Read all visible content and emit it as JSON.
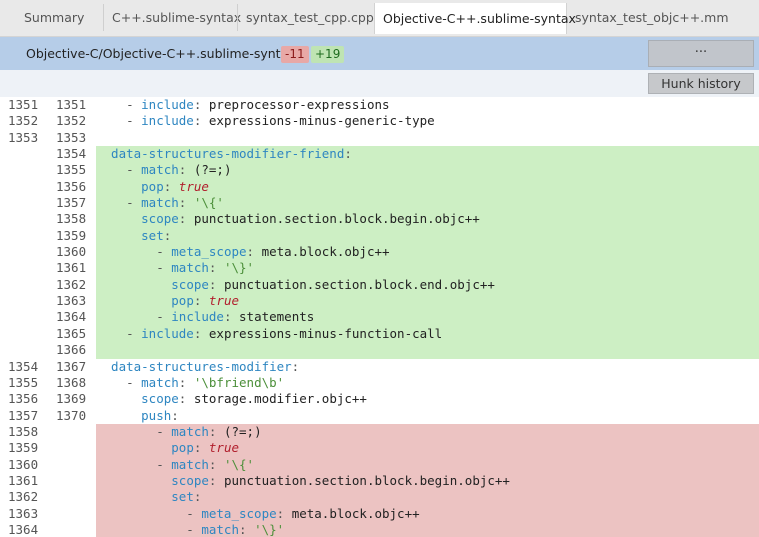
{
  "tabs": [
    {
      "label": "Summary",
      "active": false
    },
    {
      "label": "C++.sublime-syntax",
      "active": false
    },
    {
      "label": "syntax_test_cpp.cpp",
      "active": false
    },
    {
      "label": "Objective-C++.sublime-syntax",
      "active": true
    },
    {
      "label": "syntax_test_objc++.mm",
      "active": false
    }
  ],
  "file": {
    "path": "Objective-C/Objective-C++.sublime-syntax",
    "deletions": "-11",
    "additions": "+19",
    "more_label": "···"
  },
  "hunk": {
    "history_label": "Hunk history"
  },
  "colors": {
    "added_bg": "#cdefc4",
    "removed_bg": "#ecc3c2",
    "header_bg": "#b6cde8"
  },
  "lines": [
    {
      "type": "ctx",
      "old": "1351",
      "new": "1351",
      "tokens": [
        [
          "p",
          "    - "
        ],
        [
          "k",
          "include"
        ],
        [
          "p",
          ": "
        ],
        [
          "t",
          "preprocessor-expressions"
        ]
      ]
    },
    {
      "type": "ctx",
      "old": "1352",
      "new": "1352",
      "tokens": [
        [
          "p",
          "    - "
        ],
        [
          "k",
          "include"
        ],
        [
          "p",
          ": "
        ],
        [
          "t",
          "expressions-minus-generic-type"
        ]
      ]
    },
    {
      "type": "ctx",
      "old": "1353",
      "new": "1353",
      "tokens": []
    },
    {
      "type": "add",
      "old": "",
      "new": "1354",
      "tokens": [
        [
          "k",
          "  data-structures-modifier-friend"
        ],
        [
          "p",
          ":"
        ]
      ]
    },
    {
      "type": "add",
      "old": "",
      "new": "1355",
      "tokens": [
        [
          "p",
          "    - "
        ],
        [
          "k",
          "match"
        ],
        [
          "p",
          ": "
        ],
        [
          "t",
          "(?=;)"
        ]
      ]
    },
    {
      "type": "add",
      "old": "",
      "new": "1356",
      "tokens": [
        [
          "p",
          "      "
        ],
        [
          "k",
          "pop"
        ],
        [
          "p",
          ": "
        ],
        [
          "b",
          "true"
        ]
      ]
    },
    {
      "type": "add",
      "old": "",
      "new": "1357",
      "tokens": [
        [
          "p",
          "    - "
        ],
        [
          "k",
          "match"
        ],
        [
          "p",
          ": "
        ],
        [
          "s",
          "'\\{'"
        ]
      ]
    },
    {
      "type": "add",
      "old": "",
      "new": "1358",
      "tokens": [
        [
          "p",
          "      "
        ],
        [
          "k",
          "scope"
        ],
        [
          "p",
          ": "
        ],
        [
          "t",
          "punctuation.section.block.begin.objc++"
        ]
      ]
    },
    {
      "type": "add",
      "old": "",
      "new": "1359",
      "tokens": [
        [
          "p",
          "      "
        ],
        [
          "k",
          "set"
        ],
        [
          "p",
          ":"
        ]
      ]
    },
    {
      "type": "add",
      "old": "",
      "new": "1360",
      "tokens": [
        [
          "p",
          "        - "
        ],
        [
          "k",
          "meta_scope"
        ],
        [
          "p",
          ": "
        ],
        [
          "t",
          "meta.block.objc++"
        ]
      ]
    },
    {
      "type": "add",
      "old": "",
      "new": "1361",
      "tokens": [
        [
          "p",
          "        - "
        ],
        [
          "k",
          "match"
        ],
        [
          "p",
          ": "
        ],
        [
          "s",
          "'\\}'"
        ]
      ]
    },
    {
      "type": "add",
      "old": "",
      "new": "1362",
      "tokens": [
        [
          "p",
          "          "
        ],
        [
          "k",
          "scope"
        ],
        [
          "p",
          ": "
        ],
        [
          "t",
          "punctuation.section.block.end.objc++"
        ]
      ]
    },
    {
      "type": "add",
      "old": "",
      "new": "1363",
      "tokens": [
        [
          "p",
          "          "
        ],
        [
          "k",
          "pop"
        ],
        [
          "p",
          ": "
        ],
        [
          "b",
          "true"
        ]
      ]
    },
    {
      "type": "add",
      "old": "",
      "new": "1364",
      "tokens": [
        [
          "p",
          "        - "
        ],
        [
          "k",
          "include"
        ],
        [
          "p",
          ": "
        ],
        [
          "t",
          "statements"
        ]
      ]
    },
    {
      "type": "add",
      "old": "",
      "new": "1365",
      "tokens": [
        [
          "p",
          "    - "
        ],
        [
          "k",
          "include"
        ],
        [
          "p",
          ": "
        ],
        [
          "t",
          "expressions-minus-function-call"
        ]
      ]
    },
    {
      "type": "add",
      "old": "",
      "new": "1366",
      "tokens": []
    },
    {
      "type": "ctx",
      "old": "1354",
      "new": "1367",
      "tokens": [
        [
          "k",
          "  data-structures-modifier"
        ],
        [
          "p",
          ":"
        ]
      ]
    },
    {
      "type": "ctx",
      "old": "1355",
      "new": "1368",
      "tokens": [
        [
          "p",
          "    - "
        ],
        [
          "k",
          "match"
        ],
        [
          "p",
          ": "
        ],
        [
          "s",
          "'\\bfriend\\b'"
        ]
      ]
    },
    {
      "type": "ctx",
      "old": "1356",
      "new": "1369",
      "tokens": [
        [
          "p",
          "      "
        ],
        [
          "k",
          "scope"
        ],
        [
          "p",
          ": "
        ],
        [
          "t",
          "storage.modifier.objc++"
        ]
      ]
    },
    {
      "type": "ctx",
      "old": "1357",
      "new": "1370",
      "tokens": [
        [
          "p",
          "      "
        ],
        [
          "k",
          "push"
        ],
        [
          "p",
          ":"
        ]
      ]
    },
    {
      "type": "del",
      "old": "1358",
      "new": "",
      "tokens": [
        [
          "p",
          "        - "
        ],
        [
          "k",
          "match"
        ],
        [
          "p",
          ": "
        ],
        [
          "t",
          "(?=;)"
        ]
      ]
    },
    {
      "type": "del",
      "old": "1359",
      "new": "",
      "tokens": [
        [
          "p",
          "          "
        ],
        [
          "k",
          "pop"
        ],
        [
          "p",
          ": "
        ],
        [
          "b",
          "true"
        ]
      ]
    },
    {
      "type": "del",
      "old": "1360",
      "new": "",
      "tokens": [
        [
          "p",
          "        - "
        ],
        [
          "k",
          "match"
        ],
        [
          "p",
          ": "
        ],
        [
          "s",
          "'\\{'"
        ]
      ]
    },
    {
      "type": "del",
      "old": "1361",
      "new": "",
      "tokens": [
        [
          "p",
          "          "
        ],
        [
          "k",
          "scope"
        ],
        [
          "p",
          ": "
        ],
        [
          "t",
          "punctuation.section.block.begin.objc++"
        ]
      ]
    },
    {
      "type": "del",
      "old": "1362",
      "new": "",
      "tokens": [
        [
          "p",
          "          "
        ],
        [
          "k",
          "set"
        ],
        [
          "p",
          ":"
        ]
      ]
    },
    {
      "type": "del",
      "old": "1363",
      "new": "",
      "tokens": [
        [
          "p",
          "            - "
        ],
        [
          "k",
          "meta_scope"
        ],
        [
          "p",
          ": "
        ],
        [
          "t",
          "meta.block.objc++"
        ]
      ]
    },
    {
      "type": "del",
      "old": "1364",
      "new": "",
      "tokens": [
        [
          "p",
          "            - "
        ],
        [
          "k",
          "match"
        ],
        [
          "p",
          ": "
        ],
        [
          "s",
          "'\\}'"
        ]
      ]
    }
  ]
}
